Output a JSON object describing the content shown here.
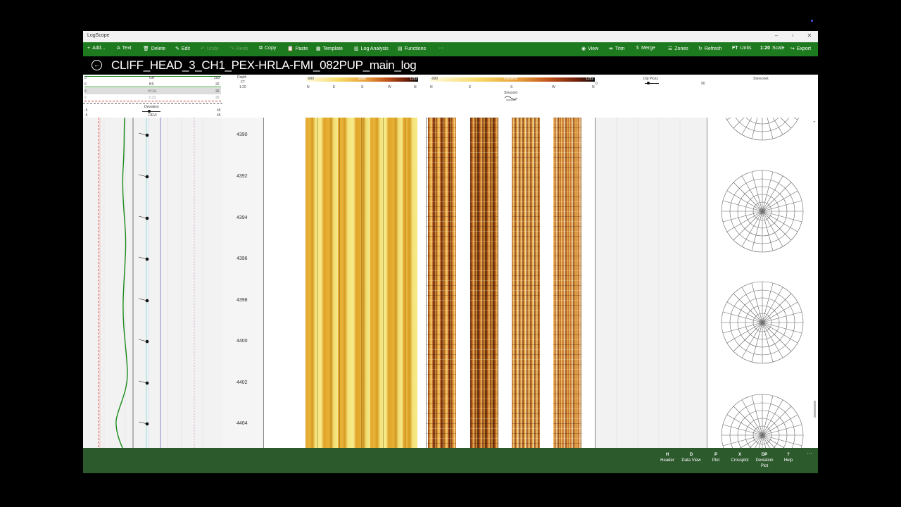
{
  "app": {
    "title": "LogScope"
  },
  "toolbar": {
    "add": "Add...",
    "text": "Text",
    "delete": "Delete",
    "edit": "Edit",
    "undo": "Undo",
    "redo": "Redo",
    "copy": "Copy",
    "paste": "Paste",
    "template": "Template",
    "log_analysis": "Log Analysis",
    "functions": "Functions",
    "more": "···",
    "view": "View",
    "trim": "Trim",
    "merge": "Merge",
    "zones": "Zones",
    "refresh": "Refresh",
    "units_icon": "FT",
    "units": "Units",
    "scale_icon": "1:20",
    "scale": "Scale",
    "export": "Export"
  },
  "document": {
    "title": "CLIFF_HEAD_3_CH1_PEX-HRLA-FMI_082PUP_main_log"
  },
  "header": {
    "gr": {
      "min": "0",
      "label": "GR",
      "max": "200"
    },
    "bs": {
      "min": "6",
      "label": "BS",
      "max": "26"
    },
    "hcal": {
      "min": "6",
      "label": "HCAL",
      "max": "26"
    },
    "c13": {
      "min": "6",
      "label": "C13",
      "max": "26"
    },
    "deviation": {
      "min": "-5",
      "label": "Deviation",
      "max": "45"
    },
    "devi": {
      "min": "-5",
      "label": "DEVI",
      "max": "45"
    },
    "depth": {
      "label": "Depth",
      "unit": "FT",
      "scale": "1:20"
    },
    "static": {
      "min": "-990",
      "label": "Static",
      "max": "1282",
      "dirs": [
        "N",
        "E",
        "S",
        "W",
        "N"
      ]
    },
    "dynamic": {
      "min": "-990",
      "label": "Dynamic",
      "max": "1282",
      "dirs": [
        "N",
        "E",
        "S",
        "W",
        "N"
      ],
      "sinusoid": "Sinusoid"
    },
    "dip_picks": {
      "label": "Dip Picks",
      "min": "0",
      "max": "90"
    },
    "stereonet": {
      "label": "Stereonet"
    }
  },
  "depths": [
    "4390",
    "4392",
    "4394",
    "4396",
    "4398",
    "4400",
    "4402",
    "4404"
  ],
  "bottom": {
    "header": {
      "key": "H",
      "label": "Header"
    },
    "data_view": {
      "key": "D",
      "label": "Data View"
    },
    "plot": {
      "key": "P",
      "label": "Plot"
    },
    "crossplot": {
      "key": "X",
      "label": "Crossplot"
    },
    "deviation_plot": {
      "key": "DP",
      "label": "Deviation",
      "label2": "Plot"
    },
    "help": {
      "key": "?",
      "label": "Help"
    },
    "more": "···"
  },
  "colors": {
    "toolbar": "#1e7a1e",
    "bottombar": "#2d5a2d",
    "gr_curve": "#1a8a1a",
    "accent": "#d97a1a"
  }
}
